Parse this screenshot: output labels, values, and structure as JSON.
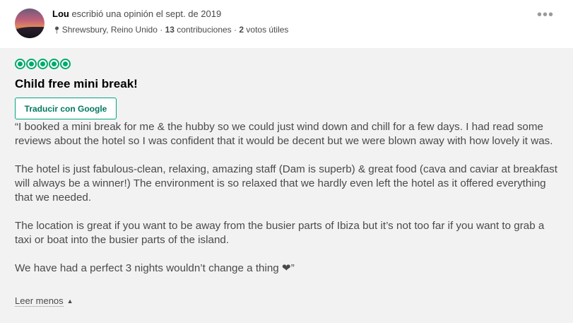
{
  "header": {
    "user": "Lou",
    "wrote": "escribió una opinión el sept. de 2019",
    "location": "Shrewsbury, Reino Unido",
    "separator": "·",
    "contributions_count": "13",
    "contributions_label": "contribuciones",
    "votes_count": "2",
    "votes_label": "votos útiles",
    "more_label": "•••"
  },
  "review": {
    "rating": "5 of 5 bubbles",
    "rating_value": 5,
    "rating_color": "#00aa6c",
    "title": "Child free mini break!",
    "translate_label": "Traducir con Google",
    "paragraphs": [
      "“I booked a mini break for me & the hubby so we could just wind down and chill for a few days. I had read some reviews about the hotel so I was confident that it would be decent but we were blown away with how lovely it was.",
      "The hotel is just fabulous-clean, relaxing, amazing staff (Dam is superb) & great food (cava and caviar at breakfast will always be a winner!) The environment is so relaxed that we hardly even left the hotel as it offered everything that we needed.",
      "The location is great if you want to be away from the busier parts of Ibiza but it’s not too far if you want to grab a taxi or boat into the busier parts of the island.",
      "We have had a perfect 3 nights wouldn’t change a thing ❤”"
    ],
    "read_less_label": "Leer menos"
  }
}
